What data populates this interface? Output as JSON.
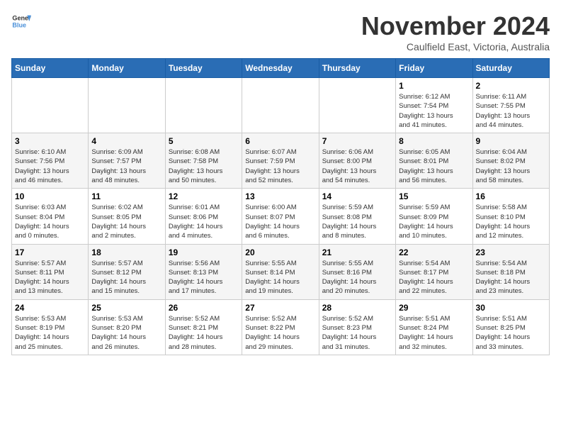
{
  "header": {
    "logo_line1": "General",
    "logo_line2": "Blue",
    "month": "November 2024",
    "location": "Caulfield East, Victoria, Australia"
  },
  "days_of_week": [
    "Sunday",
    "Monday",
    "Tuesday",
    "Wednesday",
    "Thursday",
    "Friday",
    "Saturday"
  ],
  "weeks": [
    [
      {
        "day": "",
        "info": ""
      },
      {
        "day": "",
        "info": ""
      },
      {
        "day": "",
        "info": ""
      },
      {
        "day": "",
        "info": ""
      },
      {
        "day": "",
        "info": ""
      },
      {
        "day": "1",
        "info": "Sunrise: 6:12 AM\nSunset: 7:54 PM\nDaylight: 13 hours\nand 41 minutes."
      },
      {
        "day": "2",
        "info": "Sunrise: 6:11 AM\nSunset: 7:55 PM\nDaylight: 13 hours\nand 44 minutes."
      }
    ],
    [
      {
        "day": "3",
        "info": "Sunrise: 6:10 AM\nSunset: 7:56 PM\nDaylight: 13 hours\nand 46 minutes."
      },
      {
        "day": "4",
        "info": "Sunrise: 6:09 AM\nSunset: 7:57 PM\nDaylight: 13 hours\nand 48 minutes."
      },
      {
        "day": "5",
        "info": "Sunrise: 6:08 AM\nSunset: 7:58 PM\nDaylight: 13 hours\nand 50 minutes."
      },
      {
        "day": "6",
        "info": "Sunrise: 6:07 AM\nSunset: 7:59 PM\nDaylight: 13 hours\nand 52 minutes."
      },
      {
        "day": "7",
        "info": "Sunrise: 6:06 AM\nSunset: 8:00 PM\nDaylight: 13 hours\nand 54 minutes."
      },
      {
        "day": "8",
        "info": "Sunrise: 6:05 AM\nSunset: 8:01 PM\nDaylight: 13 hours\nand 56 minutes."
      },
      {
        "day": "9",
        "info": "Sunrise: 6:04 AM\nSunset: 8:02 PM\nDaylight: 13 hours\nand 58 minutes."
      }
    ],
    [
      {
        "day": "10",
        "info": "Sunrise: 6:03 AM\nSunset: 8:04 PM\nDaylight: 14 hours\nand 0 minutes."
      },
      {
        "day": "11",
        "info": "Sunrise: 6:02 AM\nSunset: 8:05 PM\nDaylight: 14 hours\nand 2 minutes."
      },
      {
        "day": "12",
        "info": "Sunrise: 6:01 AM\nSunset: 8:06 PM\nDaylight: 14 hours\nand 4 minutes."
      },
      {
        "day": "13",
        "info": "Sunrise: 6:00 AM\nSunset: 8:07 PM\nDaylight: 14 hours\nand 6 minutes."
      },
      {
        "day": "14",
        "info": "Sunrise: 5:59 AM\nSunset: 8:08 PM\nDaylight: 14 hours\nand 8 minutes."
      },
      {
        "day": "15",
        "info": "Sunrise: 5:59 AM\nSunset: 8:09 PM\nDaylight: 14 hours\nand 10 minutes."
      },
      {
        "day": "16",
        "info": "Sunrise: 5:58 AM\nSunset: 8:10 PM\nDaylight: 14 hours\nand 12 minutes."
      }
    ],
    [
      {
        "day": "17",
        "info": "Sunrise: 5:57 AM\nSunset: 8:11 PM\nDaylight: 14 hours\nand 13 minutes."
      },
      {
        "day": "18",
        "info": "Sunrise: 5:57 AM\nSunset: 8:12 PM\nDaylight: 14 hours\nand 15 minutes."
      },
      {
        "day": "19",
        "info": "Sunrise: 5:56 AM\nSunset: 8:13 PM\nDaylight: 14 hours\nand 17 minutes."
      },
      {
        "day": "20",
        "info": "Sunrise: 5:55 AM\nSunset: 8:14 PM\nDaylight: 14 hours\nand 19 minutes."
      },
      {
        "day": "21",
        "info": "Sunrise: 5:55 AM\nSunset: 8:16 PM\nDaylight: 14 hours\nand 20 minutes."
      },
      {
        "day": "22",
        "info": "Sunrise: 5:54 AM\nSunset: 8:17 PM\nDaylight: 14 hours\nand 22 minutes."
      },
      {
        "day": "23",
        "info": "Sunrise: 5:54 AM\nSunset: 8:18 PM\nDaylight: 14 hours\nand 23 minutes."
      }
    ],
    [
      {
        "day": "24",
        "info": "Sunrise: 5:53 AM\nSunset: 8:19 PM\nDaylight: 14 hours\nand 25 minutes."
      },
      {
        "day": "25",
        "info": "Sunrise: 5:53 AM\nSunset: 8:20 PM\nDaylight: 14 hours\nand 26 minutes."
      },
      {
        "day": "26",
        "info": "Sunrise: 5:52 AM\nSunset: 8:21 PM\nDaylight: 14 hours\nand 28 minutes."
      },
      {
        "day": "27",
        "info": "Sunrise: 5:52 AM\nSunset: 8:22 PM\nDaylight: 14 hours\nand 29 minutes."
      },
      {
        "day": "28",
        "info": "Sunrise: 5:52 AM\nSunset: 8:23 PM\nDaylight: 14 hours\nand 31 minutes."
      },
      {
        "day": "29",
        "info": "Sunrise: 5:51 AM\nSunset: 8:24 PM\nDaylight: 14 hours\nand 32 minutes."
      },
      {
        "day": "30",
        "info": "Sunrise: 5:51 AM\nSunset: 8:25 PM\nDaylight: 14 hours\nand 33 minutes."
      }
    ]
  ]
}
